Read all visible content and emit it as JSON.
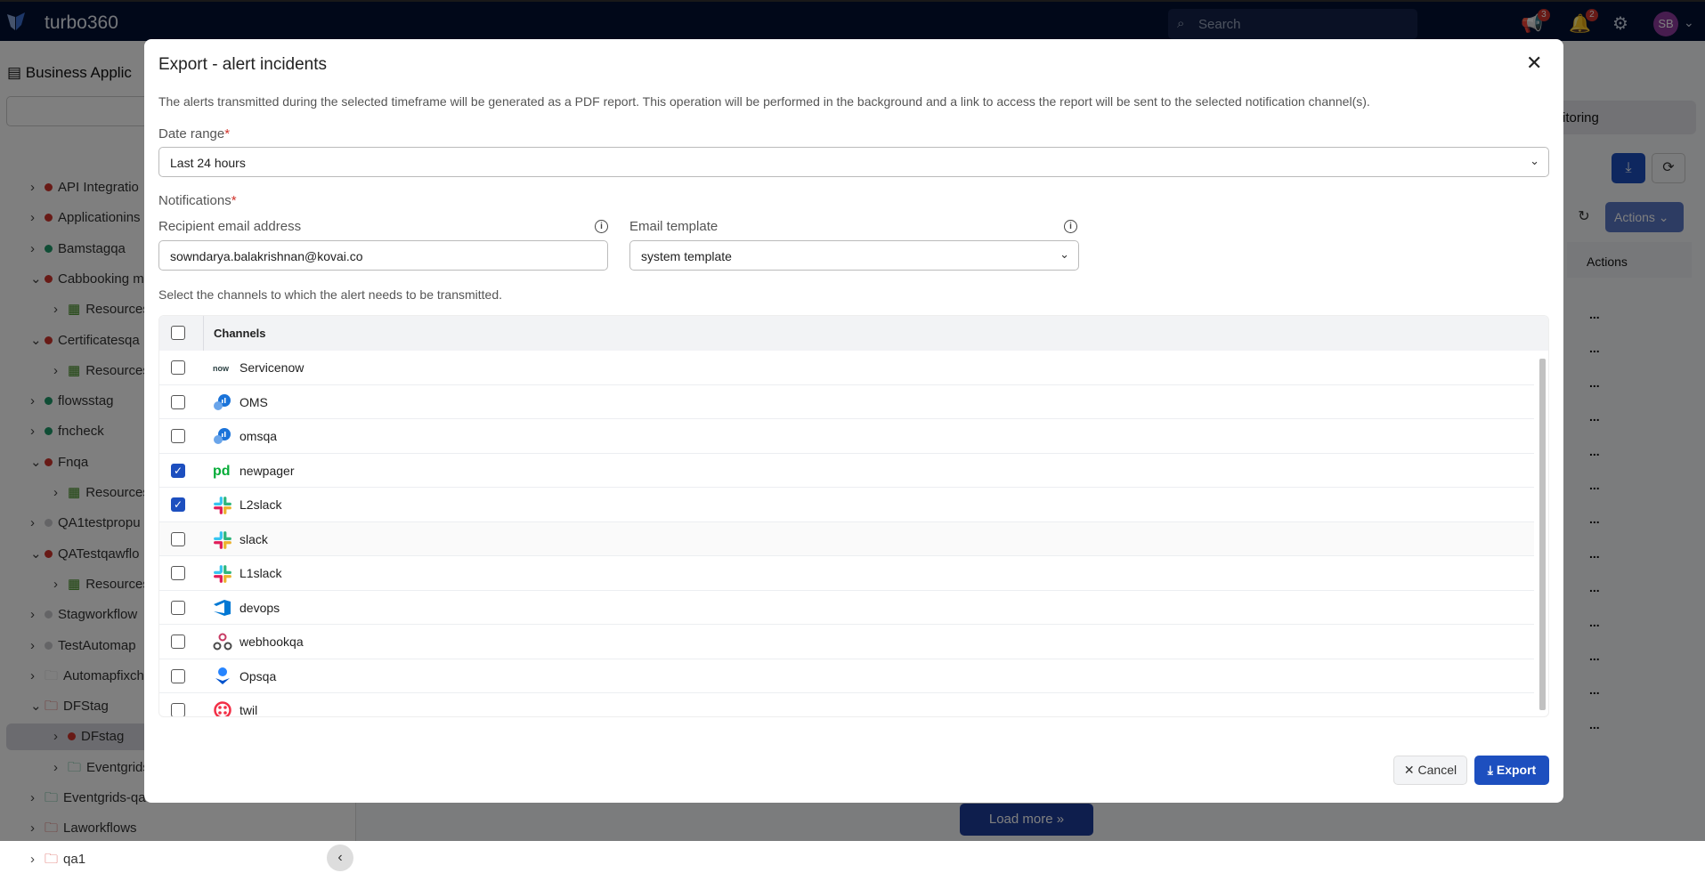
{
  "header": {
    "brand": "turbo360",
    "search_placeholder": "Search",
    "announcements_count": "3",
    "notifications_count": "2",
    "avatar_initials": "SB"
  },
  "sidebar": {
    "title": "Business Applic",
    "items": [
      {
        "label": "API Integratio",
        "status": "red",
        "level": 0,
        "expanded": false
      },
      {
        "label": "Applicationins",
        "status": "red",
        "level": 0,
        "expanded": false
      },
      {
        "label": "Bamstagqa",
        "status": "green",
        "level": 0,
        "expanded": false
      },
      {
        "label": "Cabbooking m",
        "status": "red",
        "level": 0,
        "expanded": true
      },
      {
        "label": "Resources",
        "status": "grid",
        "level": 1,
        "expanded": false
      },
      {
        "label": "Certificatesqa",
        "status": "red",
        "level": 0,
        "expanded": true
      },
      {
        "label": "Resources",
        "status": "grid",
        "level": 1,
        "expanded": false
      },
      {
        "label": "flowsstag",
        "status": "green",
        "level": 0,
        "expanded": false
      },
      {
        "label": "fncheck",
        "status": "green",
        "level": 0,
        "expanded": false
      },
      {
        "label": "Fnqa",
        "status": "red",
        "level": 0,
        "expanded": true
      },
      {
        "label": "Resources",
        "status": "grid",
        "level": 1,
        "expanded": false
      },
      {
        "label": "QA1testpropu",
        "status": "grey",
        "level": 0,
        "expanded": false
      },
      {
        "label": "QATestqawflo",
        "status": "red",
        "level": 0,
        "expanded": true
      },
      {
        "label": "Resources",
        "status": "grid",
        "level": 1,
        "expanded": false
      },
      {
        "label": "Stagworkflow",
        "status": "grey",
        "level": 0,
        "expanded": false
      },
      {
        "label": "TestAutomap",
        "status": "grey",
        "level": 0,
        "expanded": false
      },
      {
        "label": "Automapfixch",
        "status": "folder-grey",
        "level": 0,
        "expanded": false
      },
      {
        "label": "DFStag",
        "status": "folder-red",
        "level": 0,
        "expanded": true
      },
      {
        "label": "DFstag",
        "status": "red",
        "level": 1,
        "expanded": false,
        "selected": true
      },
      {
        "label": "Eventgrids",
        "status": "folder-green",
        "level": 1,
        "expanded": false
      },
      {
        "label": "Eventgrids-qa",
        "status": "folder-green",
        "level": 0,
        "expanded": false
      },
      {
        "label": "Laworkflows",
        "status": "folder-red",
        "level": 0,
        "expanded": false
      },
      {
        "label": "qa1",
        "status": "folder-red",
        "level": 0,
        "expanded": false
      }
    ]
  },
  "background": {
    "tab_partial": "itoring",
    "actions_button": "Actions",
    "actions_column": "Actions",
    "row_menu": "...",
    "load_more": "Load more"
  },
  "modal": {
    "title": "Export - alert incidents",
    "description": "The alerts transmitted during the selected timeframe will be generated as a PDF report. This operation will be performed in the background and a link to access the report will be sent to the selected notification channel(s).",
    "date_range_label": "Date range",
    "date_range_value": "Last 24 hours",
    "notifications_label": "Notifications",
    "recipient_label": "Recipient email address",
    "recipient_value": "sowndarya.balakrishnan@kovai.co",
    "template_label": "Email template",
    "template_value": "system template",
    "channels_hint": "Select the channels to which the alert needs to be transmitted.",
    "channels_header": "Channels",
    "channels": [
      {
        "name": "Servicenow",
        "icon": "servicenow-icon",
        "checked": false
      },
      {
        "name": "OMS",
        "icon": "oms-icon",
        "checked": false
      },
      {
        "name": "omsqa",
        "icon": "oms-icon",
        "checked": false
      },
      {
        "name": "newpager",
        "icon": "pagerduty-icon",
        "checked": true
      },
      {
        "name": "L2slack",
        "icon": "slack-icon",
        "checked": true
      },
      {
        "name": "slack",
        "icon": "slack-icon",
        "checked": false
      },
      {
        "name": "L1slack",
        "icon": "slack-icon",
        "checked": false
      },
      {
        "name": "devops",
        "icon": "azure-devops-icon",
        "checked": false
      },
      {
        "name": "webhookqa",
        "icon": "webhook-icon",
        "checked": false
      },
      {
        "name": "Opsqa",
        "icon": "opsgenie-icon",
        "checked": false
      },
      {
        "name": "twil",
        "icon": "twilio-icon",
        "checked": false
      }
    ],
    "cancel_label": "Cancel",
    "export_label": "Export"
  },
  "colors": {
    "header_bg": "#031033",
    "primary": "#1d4fbf",
    "status_red": "#d0342c",
    "status_green": "#1f9a6a",
    "required": "#d0342c"
  }
}
